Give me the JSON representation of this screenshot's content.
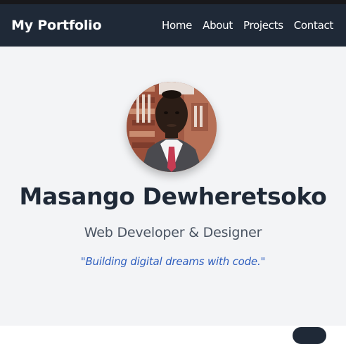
{
  "navbar": {
    "brand": "My Portfolio",
    "links": [
      {
        "label": "Home"
      },
      {
        "label": "About"
      },
      {
        "label": "Projects"
      },
      {
        "label": "Contact"
      }
    ]
  },
  "hero": {
    "name": "Masango Dewheretsoko",
    "role": "Web Developer & Designer",
    "tagline": "\"Building digital dreams with code.\""
  },
  "colors": {
    "navbar_bg": "#1f2937",
    "hero_bg": "#f3f4f6",
    "name_text": "#1f2937",
    "tagline_text": "#2f5fbf"
  }
}
